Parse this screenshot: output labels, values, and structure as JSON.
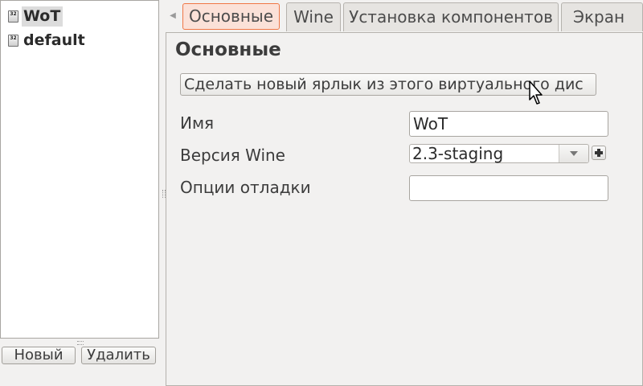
{
  "prefix_list": {
    "items": [
      {
        "label": "WoT",
        "icon": "wine-bottle-32-icon",
        "selected": true
      },
      {
        "label": "default",
        "icon": "wine-bottle-32-icon",
        "selected": false
      }
    ],
    "icon_text": "32"
  },
  "left_buttons": {
    "new_label": "Новый",
    "delete_label": "Удалить"
  },
  "tabs": [
    {
      "label": "Основные",
      "active": true
    },
    {
      "label": "Wine",
      "active": false
    },
    {
      "label": "Установка компонентов",
      "active": false
    },
    {
      "label": "Экран",
      "active": false
    }
  ],
  "page": {
    "title": "Основные",
    "shortcut_button": "Сделать новый ярлык из этого виртуального дис",
    "fields": {
      "name_label": "Имя",
      "name_value": "WoT",
      "wine_version_label": "Версия Wine",
      "wine_version_value": "2.3-staging",
      "debug_options_label": "Опции отладки",
      "debug_options_value": ""
    }
  },
  "colors": {
    "active_tab_border": "#f07746",
    "active_tab_bg": "#fbe1d8",
    "window_bg": "#f2f1f0"
  }
}
